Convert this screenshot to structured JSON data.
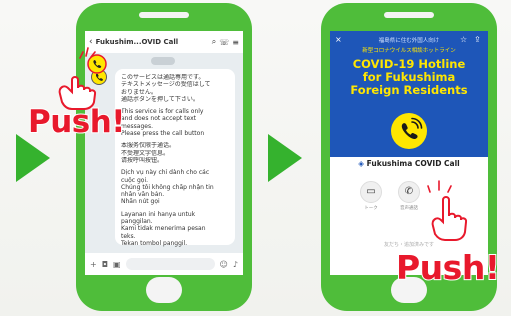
{
  "push_label": "Push!",
  "left_screen": {
    "header_title": "Fukushim...OVID Call",
    "date_pill": "",
    "message_lines": [
      "このサービスは通話専用です。",
      "テキストメッセージの受信はして",
      "おりません。",
      "通話ボタンを押して下さい。",
      "",
      "This service is for calls only",
      "and does not accept text",
      "messages.",
      "Please press the call button",
      "",
      "本服务仅限于通话。",
      "不受理文字信息。",
      "请按呼叫按钮。",
      "",
      "Dịch vụ này chỉ dành cho các",
      "cuộc gọi.",
      "Chúng tôi không chấp nhận tin",
      "nhắn văn bản.",
      "Nhấn nút gọi",
      "",
      "Layanan ini hanya untuk",
      "panggilan.",
      "Kami tidak menerima pesan",
      "teks.",
      "Tekan tombol panggil."
    ]
  },
  "right_screen": {
    "top_line_1": "福島県に住む外国人向け",
    "top_line_2": "新型コロナウイルス相談ホットライン",
    "title_lines": [
      "COVID-19 Hotline",
      "for Fukushima",
      "Foreign Residents"
    ],
    "account_name": "Fukushima COVID Call",
    "call_label": "音声通話",
    "chat_label": "トーク",
    "footer_text": "友だち・追加済みです"
  },
  "colors": {
    "phone_green": "#4fbd3a",
    "arrow_green": "#35b22e",
    "hotline_blue": "#1e56b8",
    "title_yellow": "#ffe600",
    "push_red": "#e8192c"
  }
}
